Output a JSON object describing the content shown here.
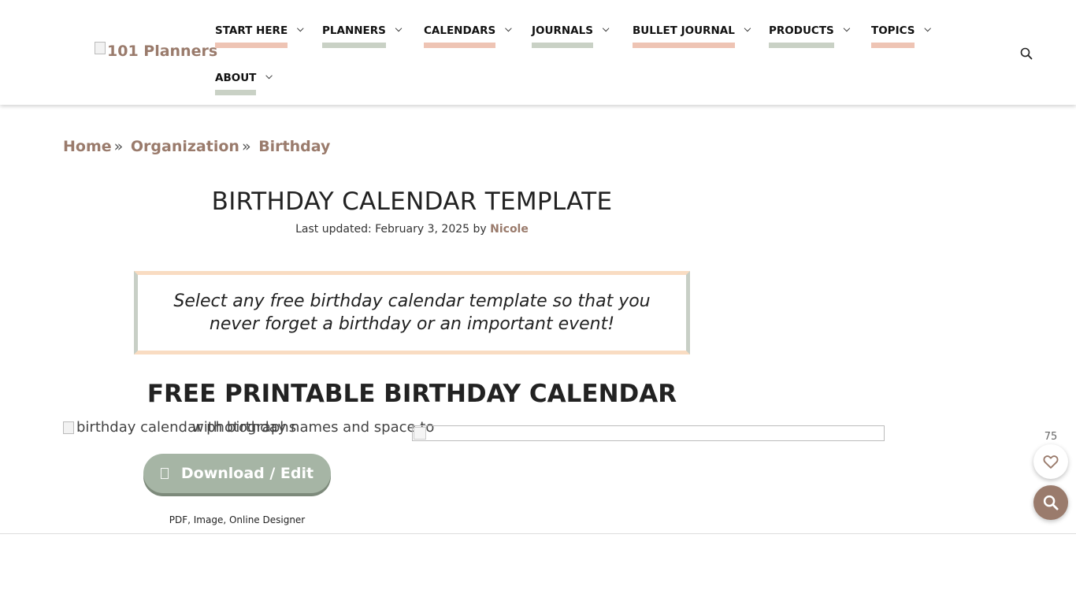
{
  "header": {
    "logo_text": "101 Planners",
    "nav": [
      {
        "label": "START HERE"
      },
      {
        "label": "PLANNERS"
      },
      {
        "label": "CALENDARS"
      },
      {
        "label": "JOURNALS"
      },
      {
        "label": "BULLET JOURNAL"
      },
      {
        "label": "PRODUCTS"
      },
      {
        "label": "TOPICS"
      },
      {
        "label": "ABOUT"
      }
    ],
    "search_icon": "search-icon"
  },
  "breadcrumb": {
    "items": [
      "Home",
      "Organization",
      "Birthday"
    ],
    "separator": "»"
  },
  "article": {
    "title": "BIRTHDAY CALENDAR TEMPLATE",
    "updated_prefix": "Last updated: February 3, 2025 by",
    "author": "Nicole",
    "intro": "Select any free birthday calendar template so that you never forget a birthday or an important event!",
    "section_title": "FREE PRINTABLE BIRTHDAY CALENDAR",
    "image_alt_1": "birthday calendar photographs",
    "image_alt_2": "with birthday names and space to",
    "download_label": "Download / Edit",
    "formats": "PDF, Image, Online Designer"
  },
  "floating": {
    "like_count": "75",
    "heart_icon": "heart-icon",
    "search_icon": "search-icon"
  },
  "colors": {
    "accent_brown": "#9a7b6c",
    "underline_peach": "#eec4b4",
    "underline_sage": "#c9d1c5",
    "button_sage": "#a6b5a5"
  }
}
